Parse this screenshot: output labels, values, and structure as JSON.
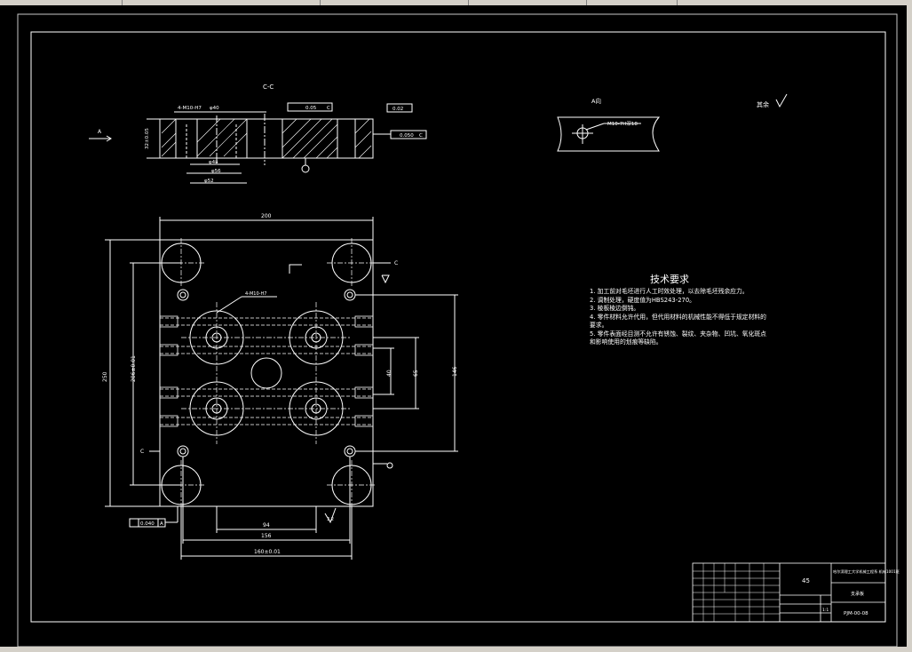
{
  "drawing": {
    "section_label": "C-C",
    "view_a_label": "A向",
    "arrow_a": "A",
    "remaining_roughness": "其余",
    "thread_callout": "M10-7H深18",
    "hole_callout_top": "4-M10-H7",
    "depth_label": "32±0.05",
    "dims_top": [
      "φ48",
      "φ56",
      "φ52",
      "φ40"
    ],
    "tolerance_frames": [
      "0.05",
      "0.02",
      "0.050"
    ],
    "datum_labels": [
      "A",
      "C",
      "C",
      "A"
    ],
    "dims_plan": {
      "width_top": "200",
      "height_left": "250",
      "inner_left": "206±0.01",
      "right_146": "146",
      "right_40": "40",
      "right_65": "65",
      "bottom_94": "94",
      "bottom_156": "156",
      "bottom_160": "160±0.01"
    },
    "roughness_value": "3.2",
    "bottom_tolerance": "0.040",
    "bottom_datum": "A"
  },
  "tech_notes": {
    "title": "技术要求",
    "items": [
      "1. 加工前对毛坯进行人工时效处理，以去除毛坯残余应力。",
      "2. 调制处理，硬度值为HBS243-270。",
      "3. 棱板棱边倒钝。",
      "4. 零件材料允许代用，但代用材料的机械性能不得低于规定材料的要求。",
      "5. 零件表面经目测不允许有锈蚀、裂纹、夹杂物、凹坑、氧化斑点和影响使用的划痕等缺陷。"
    ]
  },
  "title_block": {
    "material": "45",
    "school": "哈尔滨理工大学机械工程系 机械1001班",
    "part_name": "支承板",
    "drawing_number": "PJM-00-08",
    "scale": "1:1"
  },
  "colors": {
    "background": "#000000",
    "lines": "#ffffff",
    "chrome": "#d4d0c8"
  }
}
